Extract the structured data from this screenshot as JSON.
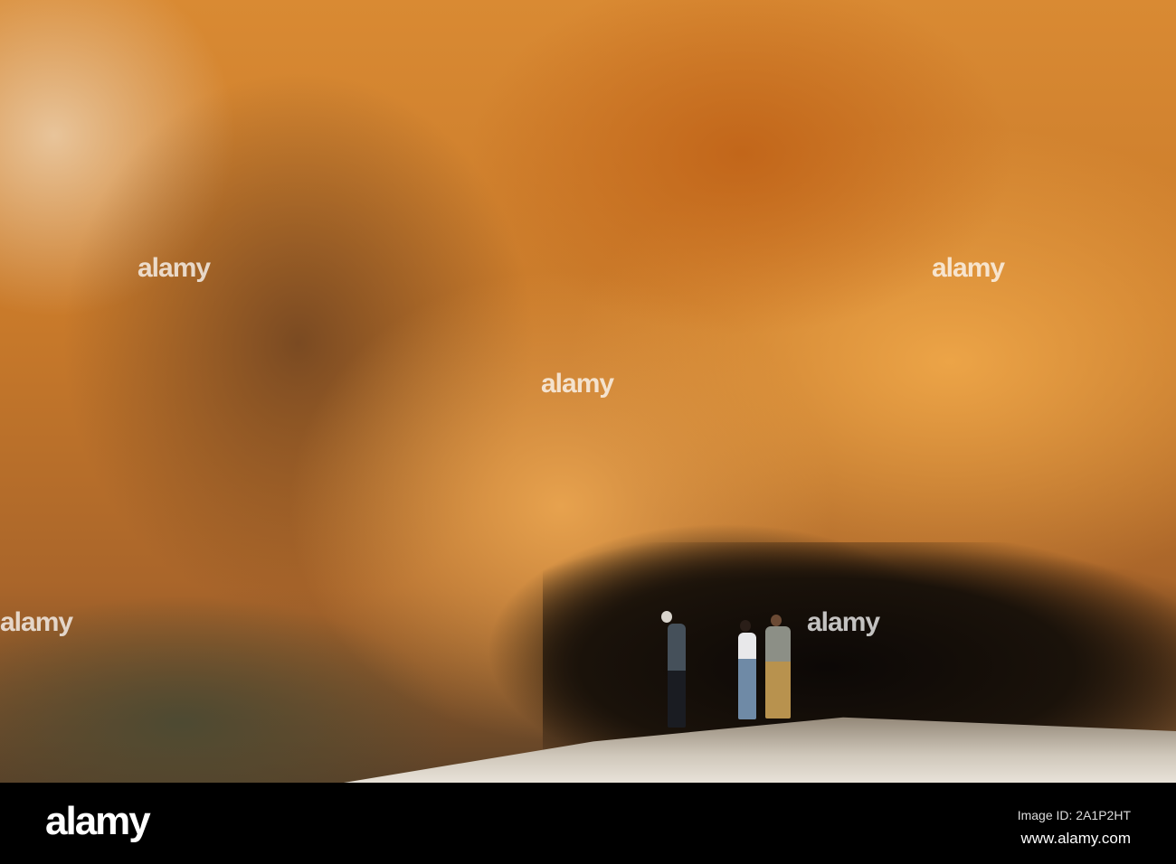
{
  "watermark": {
    "text": "alamy"
  },
  "footer": {
    "logo": "alamy",
    "image_id": "Image ID: 2A1P2HT",
    "url": "www.alamy.com"
  }
}
